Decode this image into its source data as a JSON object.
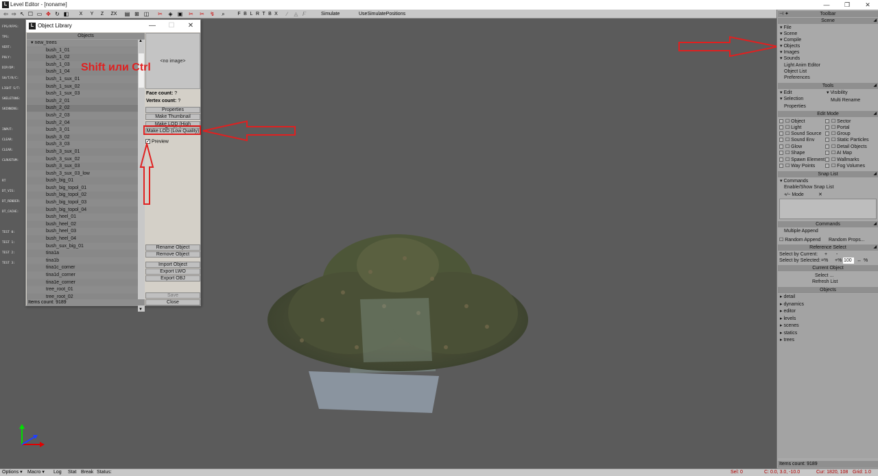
{
  "window": {
    "title": "Level Editor - [noname]",
    "app_icon": "L"
  },
  "toolbar": {
    "letters": [
      "X",
      "Y",
      "Z",
      "ZX"
    ],
    "snap_letters": [
      "F",
      "B",
      "L",
      "R",
      "T",
      "B",
      "X"
    ],
    "simulate": "Simulate",
    "use_simulate": "UseSimulatePositions"
  },
  "stats": [
    "FPS/RFPS:",
    "TPS:",
    "VERT:",
    "POLY:",
    "DIP/DP:",
    "SH/T/R/C:",
    "LIGHT S/T:",
    "SKELETONS:",
    "SKINNING:",
    "",
    "INPUT:",
    "CLEAR:",
    "CLEAR:",
    "CLRUSTUM:",
    "",
    "RT",
    "DT_VIS:",
    "DT_RENDER:",
    "DT_CACHE:",
    "",
    "TEST 0:",
    "TEST 1:",
    "TEST 2:",
    "TEST 3:"
  ],
  "object_library": {
    "title": "Object Library",
    "list_header": "Objects",
    "group": "new_trees",
    "items": [
      "bush_1_01",
      "bush_1_02",
      "bush_1_03",
      "bush_1_04",
      "bush_1_sux_01",
      "bush_1_sux_02",
      "bush_1_sux_03",
      "bush_2_01",
      "bush_2_02",
      "bush_2_03",
      "bush_2_04",
      "bush_3_01",
      "bush_3_02",
      "bush_3_03",
      "bush_3_sux_01",
      "bush_3_sux_02",
      "bush_3_sux_03",
      "bush_3_sux_03_low",
      "bush_big_01",
      "bush_big_topol_01",
      "bush_big_topol_02",
      "bush_big_topol_03",
      "bush_big_topol_04",
      "bush_heel_01",
      "bush_heel_02",
      "bush_heel_03",
      "bush_heel_04",
      "bush_sux_big_01",
      "tina1a",
      "tina1b",
      "tina1c_corner",
      "tina1d_corner",
      "tina1e_corner",
      "tree_root_01",
      "tree_root_02"
    ],
    "items_count": "Items count: 9189",
    "preview_text": "<no image>",
    "face_count_label": "Face count:",
    "face_count_value": "?",
    "vertex_count_label": "Vertex count:",
    "vertex_count_value": "?",
    "buttons": {
      "properties": "Properties",
      "make_thumbnail": "Make Thumbnail",
      "make_lod_hq": "Make LOD (High Quality)",
      "make_lod_lq": "Make LOD (Low Quality)",
      "preview": "Preview",
      "rename": "Rename Object",
      "remove": "Remove Object",
      "import": "Import Object",
      "export_lwo": "Export LWO",
      "export_obj": "Export OBJ",
      "save": "Save",
      "close": "Close"
    },
    "preview_checked": true
  },
  "annotation": {
    "text": "Shift или Ctrl",
    "color": "#e02020"
  },
  "right_panel": {
    "toolbar_title": "Toolbar",
    "scene_title": "Scene",
    "scene_items": [
      "File",
      "Scene",
      "Compile",
      "Objects",
      "Images",
      "Sounds"
    ],
    "scene_plain": [
      "Light Anim Editor",
      "Object List",
      "Preferences"
    ],
    "tools_title": "Tools",
    "tools": {
      "edit": "Edit",
      "visibility": "Visibility",
      "selection": "Selection",
      "multi_rename": "Multi Rename",
      "properties": "Properties"
    },
    "edit_mode_title": "Edit Mode",
    "edit_mode_left": [
      "Object",
      "Light",
      "Sound Source",
      "Sound Env",
      "Glow",
      "Shape",
      "Spawn Element",
      "Way Points"
    ],
    "edit_mode_right": [
      "Sector",
      "Portal",
      "Group",
      "Static Particles",
      "Detail Objects",
      "AI Map",
      "Wallmarks",
      "Fog Volumes"
    ],
    "snap_title": "Snap List",
    "snap_commands": "Commands",
    "snap_enable": "Enable/Show Snap List",
    "snap_mode": "Mode",
    "commands_title": "Commands",
    "multiple_append": "Multiple Append",
    "random_append": "Random Append",
    "random_props": "Random Props...",
    "ref_select_title": "Reference Select",
    "select_by_current": "Select by Current:",
    "select_by_selected": "Select by Selected:",
    "plus": "+",
    "minus": "-",
    "pct_minus": "=%",
    "pct_plus": "+%",
    "pct_value": "100",
    "pct_sign": "%",
    "current_object_title": "Current Object",
    "select": "Select ...",
    "refresh_list": "Refresh List",
    "objects_title": "Objects",
    "object_folders": [
      "detail",
      "dynamics",
      "editor",
      "levels",
      "scenes",
      "statics",
      "trees"
    ],
    "items_count": "Items count: 9189"
  },
  "statusbar": {
    "options": "Options",
    "macro": "Macro",
    "log": "Log",
    "stat": "Stat",
    "break": "Break",
    "status": "Status:",
    "sel": "Sel: 0",
    "coords": "C: 0.0, 3.0, -10.0",
    "cur": "Cur: 1820, 108",
    "grid": "Grid: 1.0"
  }
}
